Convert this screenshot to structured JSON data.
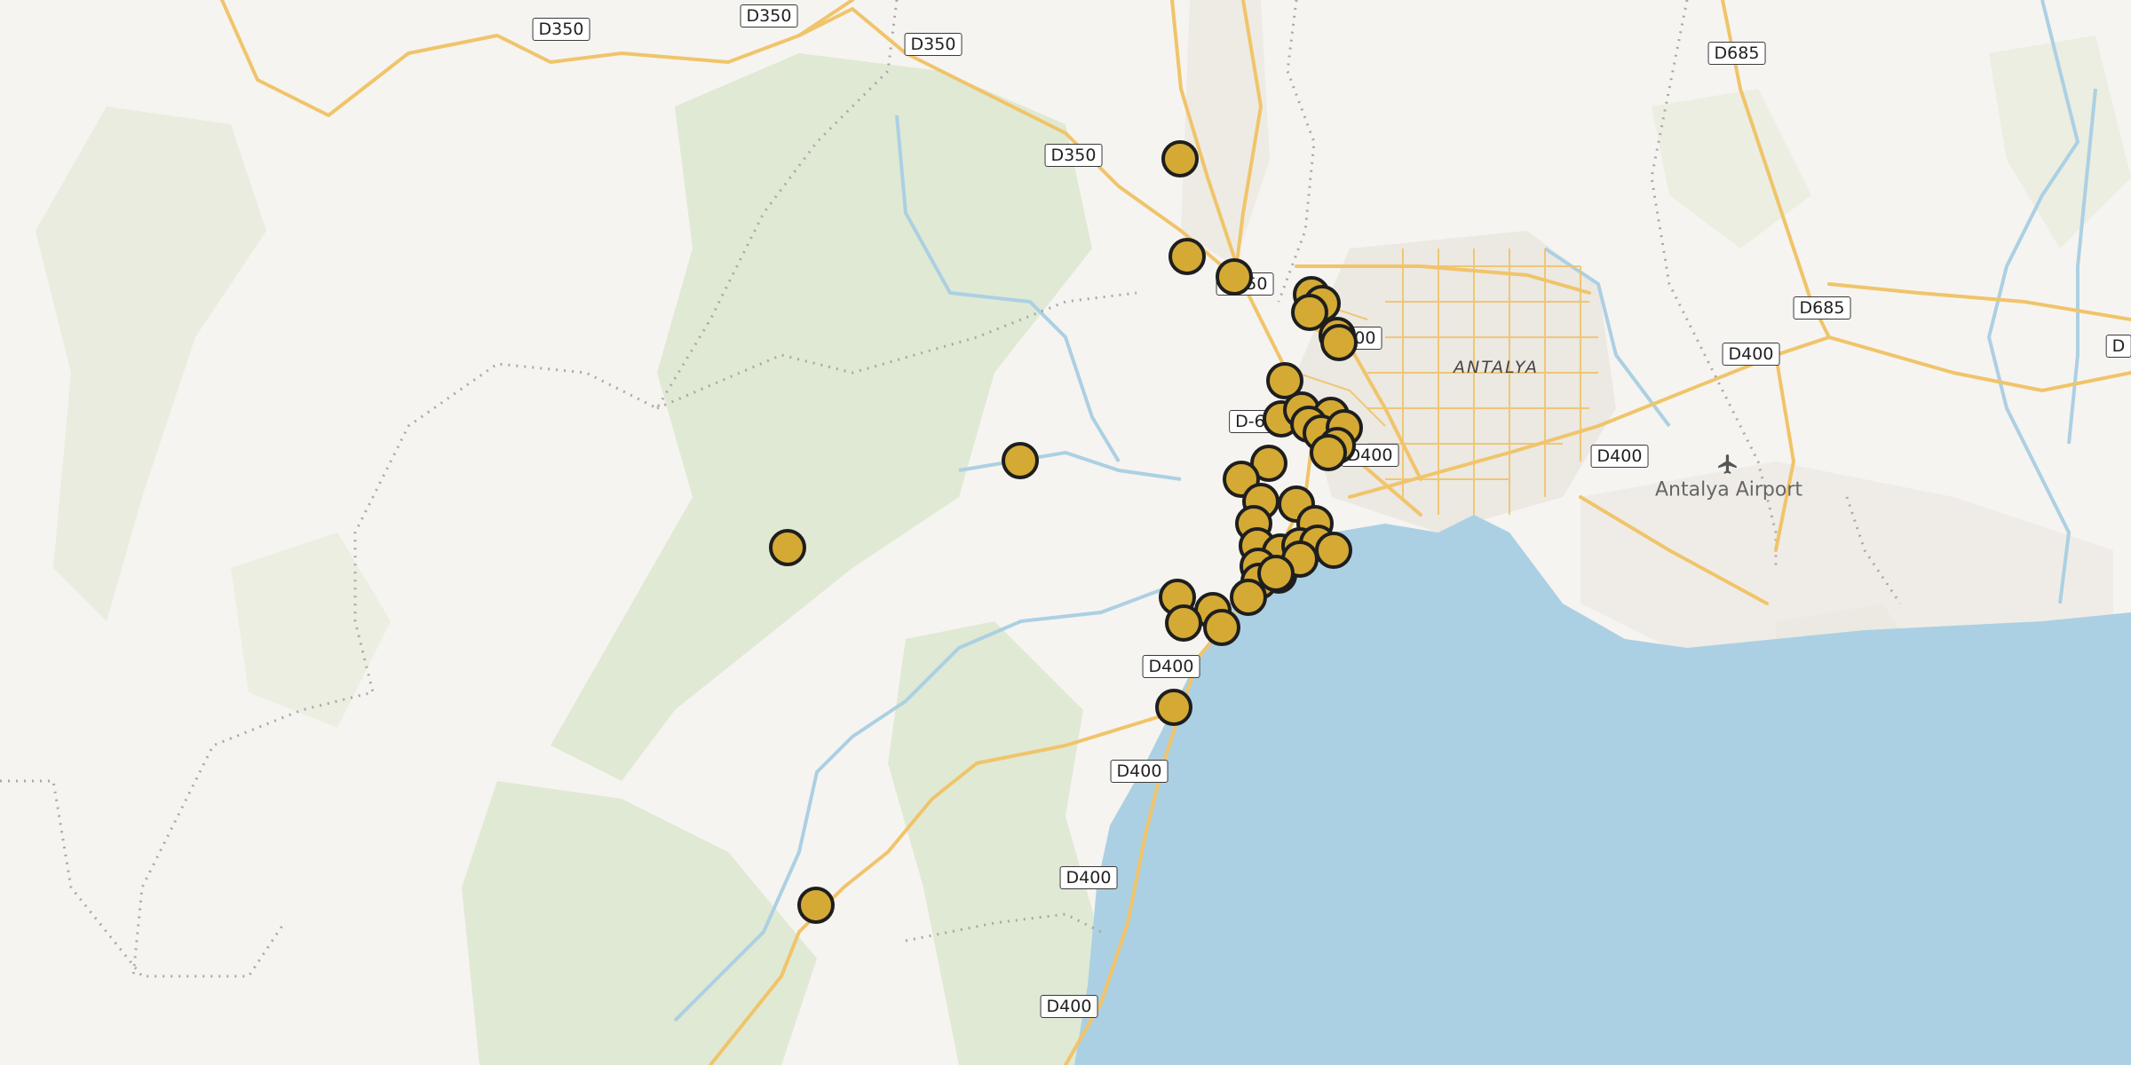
{
  "map": {
    "place_labels": {
      "city": "ANTALYA",
      "airport": "Antalya Airport"
    },
    "airport_icon": "airplane-icon",
    "colors": {
      "land": "#f6f4f0",
      "forest": "#dfe8d2",
      "water": "#acd0e3",
      "road": "#f5c96b",
      "marker_fill": "#d4aa34",
      "marker_stroke": "#1e1e1e"
    },
    "road_shields": [
      {
        "label": "D350"
      },
      {
        "label": "D350"
      },
      {
        "label": "D350"
      },
      {
        "label": "D350"
      },
      {
        "label": "D350"
      },
      {
        "label": "D685"
      },
      {
        "label": "D685"
      },
      {
        "label": "D400"
      },
      {
        "label": "D400"
      },
      {
        "label": "D400"
      },
      {
        "label": "D400"
      },
      {
        "label": "D400"
      },
      {
        "label": "D400"
      },
      {
        "label": "D400"
      },
      {
        "label": "D-650"
      },
      {
        "label": "D400"
      },
      {
        "label": "D"
      }
    ],
    "marker_count": 42
  }
}
